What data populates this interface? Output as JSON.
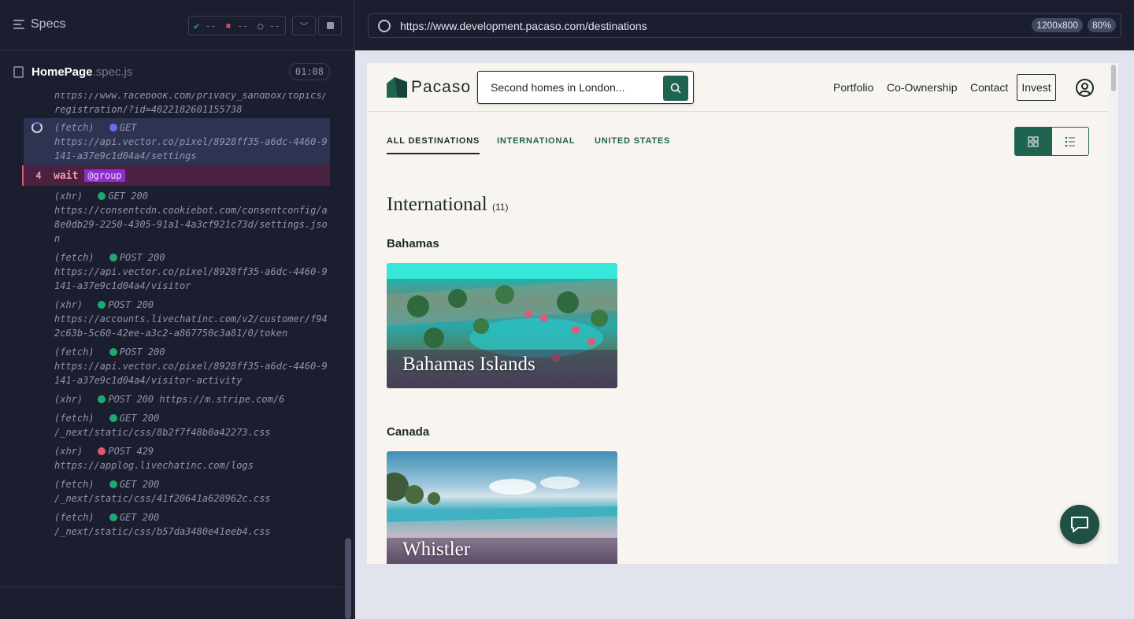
{
  "runner": {
    "title": "Specs",
    "stats": {
      "passed": "--",
      "failed": "--",
      "pending": "--"
    },
    "spec": {
      "name": "HomePage",
      "ext": ".spec.js",
      "duration": "01:08"
    }
  },
  "log": {
    "partial_url": "https://www.facebook.com/privacy_sandbox/topics/registration/?id=4022182601155738",
    "active": {
      "kind": "(fetch)",
      "method": "GET",
      "url": "https://api.vector.co/pixel/8928ff35-a6dc-4460-9141-a37e9c1d04a4/settings"
    },
    "wait": {
      "num": "4",
      "cmd": "wait",
      "alias": "@group"
    },
    "entries": [
      {
        "kind": "(xhr)",
        "status": "GET 200",
        "url": "https://consentcdn.cookiebot.com/consentconfig/a8e0db29-2250-4305-91a1-4a3cf921c73d/settings.json",
        "color": "#1fa971"
      },
      {
        "kind": "(fetch)",
        "status": "POST 200",
        "url": "https://api.vector.co/pixel/8928ff35-a6dc-4460-9141-a37e9c1d04a4/visitor",
        "color": "#1fa971"
      },
      {
        "kind": "(xhr)",
        "status": "POST 200",
        "url": "https://accounts.livechatinc.com/v2/customer/f942c63b-5c60-42ee-a3c2-a867750c3a81/0/token",
        "color": "#1fa971"
      },
      {
        "kind": "(fetch)",
        "status": "POST 200",
        "url": "https://api.vector.co/pixel/8928ff35-a6dc-4460-9141-a37e9c1d04a4/visitor-activity",
        "color": "#1fa971"
      },
      {
        "kind": "(xhr)",
        "status": "POST 200 https://m.stripe.com/6",
        "url": "",
        "color": "#1fa971"
      },
      {
        "kind": "(fetch)",
        "status": "GET 200",
        "url": "/_next/static/css/8b2f7f48b0a42273.css",
        "color": "#1fa971"
      },
      {
        "kind": "(xhr)",
        "status": "POST 429",
        "url": "https://applog.livechatinc.com/logs",
        "color": "#e45770"
      },
      {
        "kind": "(fetch)",
        "status": "GET 200",
        "url": "/_next/static/css/41f20641a628962c.css",
        "color": "#1fa971"
      },
      {
        "kind": "(fetch)",
        "status": "GET 200",
        "url": "/_next/static/css/b57da3480e41eeb4.css",
        "color": "#1fa971"
      }
    ]
  },
  "browser": {
    "url": "https://www.development.pacaso.com/destinations",
    "viewport": "1200x800",
    "zoom": "80%"
  },
  "site": {
    "logo": "Pacaso",
    "search_placeholder": "Second homes in London...",
    "nav": [
      "Portfolio",
      "Co-Ownership",
      "Contact"
    ],
    "invest": "Invest",
    "tabs": [
      "ALL DESTINATIONS",
      "INTERNATIONAL",
      "UNITED STATES"
    ],
    "section_title": "International",
    "section_count": "(11)",
    "regions": [
      {
        "name": "Bahamas",
        "card": "Bahamas Islands"
      },
      {
        "name": "Canada",
        "card": "Whistler"
      }
    ],
    "colors": {
      "brand": "#1f6351",
      "bg": "#f8f5f1"
    }
  }
}
